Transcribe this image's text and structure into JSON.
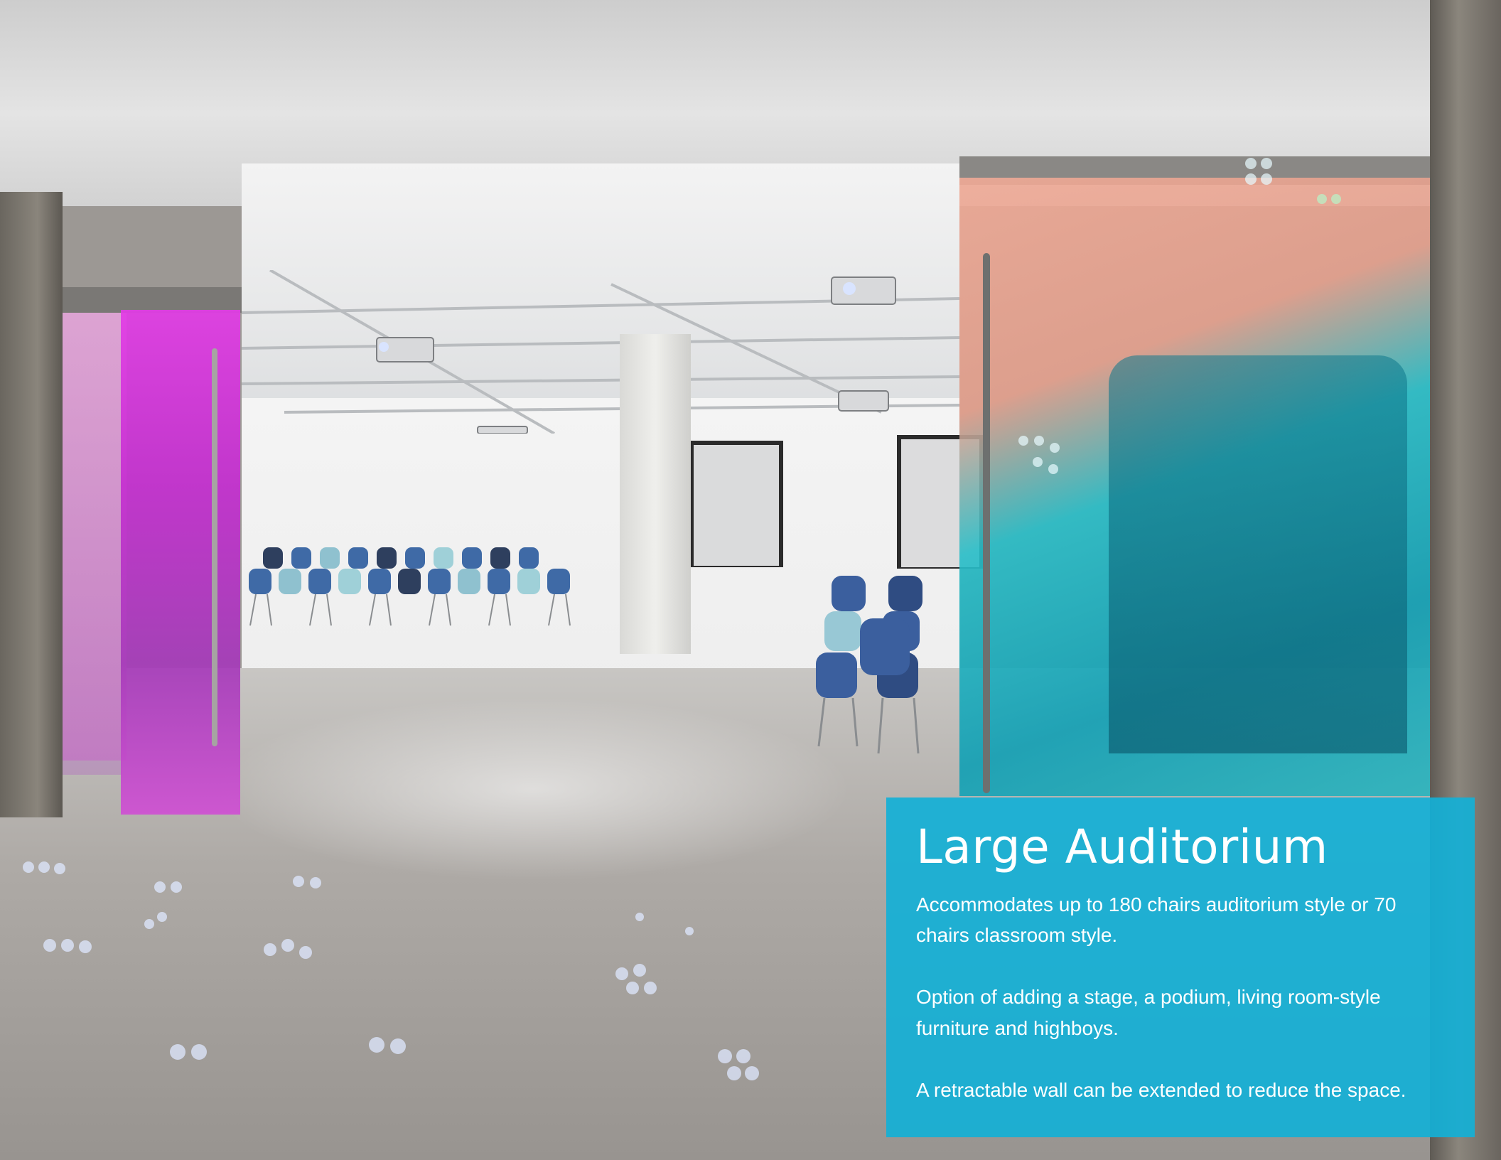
{
  "caption": {
    "title": "Large Auditorium",
    "paragraphs": [
      "Accommodates up to 180 chairs auditorium style or 70 chairs classroom style.",
      "Option of adding a stage, a podium, living room-style furniture and highboys.",
      "A retractable wall can be extended to reduce the space."
    ]
  },
  "colors": {
    "caption_background": "#13b0d6",
    "pink_glass": "#d23ed8",
    "teal_glass": "#21b7c6"
  }
}
